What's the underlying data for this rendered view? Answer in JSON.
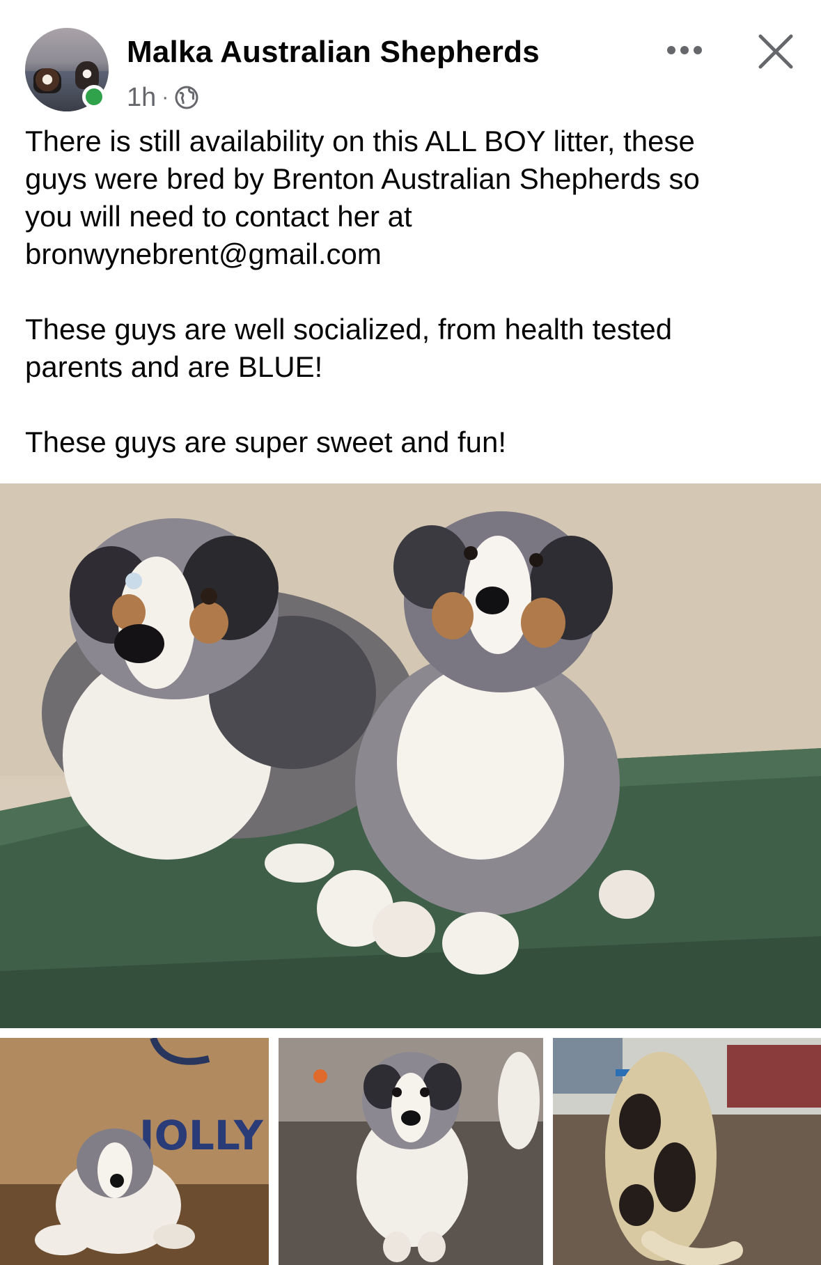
{
  "post": {
    "page_name": "Malka Australian Shepherds",
    "time": "1h",
    "separator": "·",
    "privacy_icon": "globe-icon",
    "more_icon": "more-horizontal-icon",
    "close_icon": "close-icon",
    "online_status_color": "#31a24c",
    "paragraphs": [
      [
        "There is still availability on this ALL BOY litter,  these",
        "guys were bred by Brenton Australian Shepherds so",
        "you will need to contact her at",
        "bronwynebrent@gmail.com"
      ],
      [
        "These guys are well socialized, from health tested",
        "parents and are BLUE!"
      ],
      [
        "These guys are super sweet and fun!"
      ]
    ]
  },
  "photos": {
    "thumb1_sign_text": "JOLLY"
  }
}
